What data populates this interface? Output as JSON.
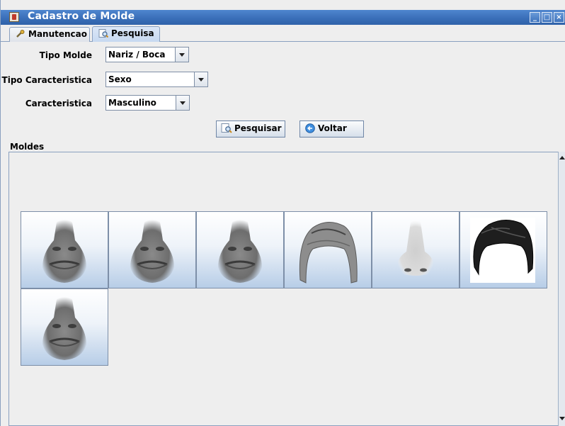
{
  "window": {
    "title": "Cadastro de Molde",
    "controls": [
      "minimize-icon",
      "maximize-icon",
      "close-icon"
    ]
  },
  "tabs": [
    {
      "label": "Manutencao",
      "icon": "wrench-icon",
      "active": false
    },
    {
      "label": "Pesquisa",
      "icon": "search-icon",
      "active": true
    }
  ],
  "form": {
    "tipo_molde": {
      "label": "Tipo Molde",
      "value": "Nariz / Boca"
    },
    "tipo_caracteristica": {
      "label": "Tipo Caracteristica",
      "value": "Sexo"
    },
    "caracteristica": {
      "label": "Caracteristica",
      "value": "Masculino"
    }
  },
  "buttons": {
    "pesquisar": "Pesquisar",
    "voltar": "Voltar"
  },
  "results": {
    "label": "Moldes",
    "items": [
      {
        "kind": "nose-mouth"
      },
      {
        "kind": "nose-mouth"
      },
      {
        "kind": "nose-mouth"
      },
      {
        "kind": "hair-light"
      },
      {
        "kind": "nose"
      },
      {
        "kind": "hair-dark"
      },
      {
        "kind": "nose-mouth"
      }
    ]
  },
  "colors": {
    "titlebar": "#3a6fb9",
    "tab_active": "#c7d9f1",
    "thumb_gradient_bottom": "#b7cde7"
  }
}
